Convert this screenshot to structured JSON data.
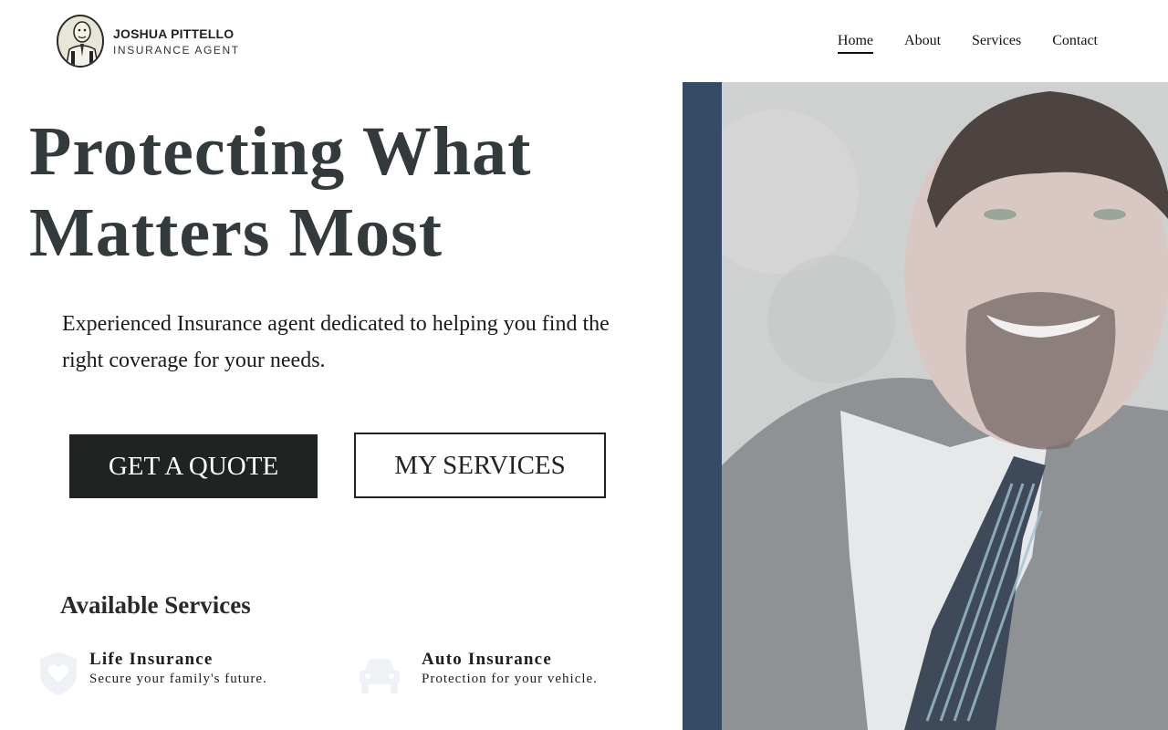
{
  "brand": {
    "name": "JOSHUA PITTELLO",
    "subtitle": "INSURANCE AGENT"
  },
  "nav": {
    "items": [
      {
        "label": "Home",
        "active": true
      },
      {
        "label": "About",
        "active": false
      },
      {
        "label": "Services",
        "active": false
      },
      {
        "label": "Contact",
        "active": false
      }
    ]
  },
  "hero": {
    "title_line1": "Protecting What",
    "title_line2": "Matters Most",
    "description": "Experienced Insurance agent dedicated to helping you find the right coverage for your needs.",
    "primary_button": "GET A QUOTE",
    "secondary_button": "MY SERVICES"
  },
  "services": {
    "heading": "Available Services",
    "items": [
      {
        "title": "Life Insurance",
        "description": "Secure your family's future.",
        "icon": "shield-heart-icon"
      },
      {
        "title": "Auto Insurance",
        "description": "Protection for your vehicle.",
        "icon": "car-icon"
      }
    ]
  },
  "colors": {
    "accent_bar": "#354b66",
    "primary_button_bg": "#1f2322",
    "heading_text": "#333a3c"
  }
}
